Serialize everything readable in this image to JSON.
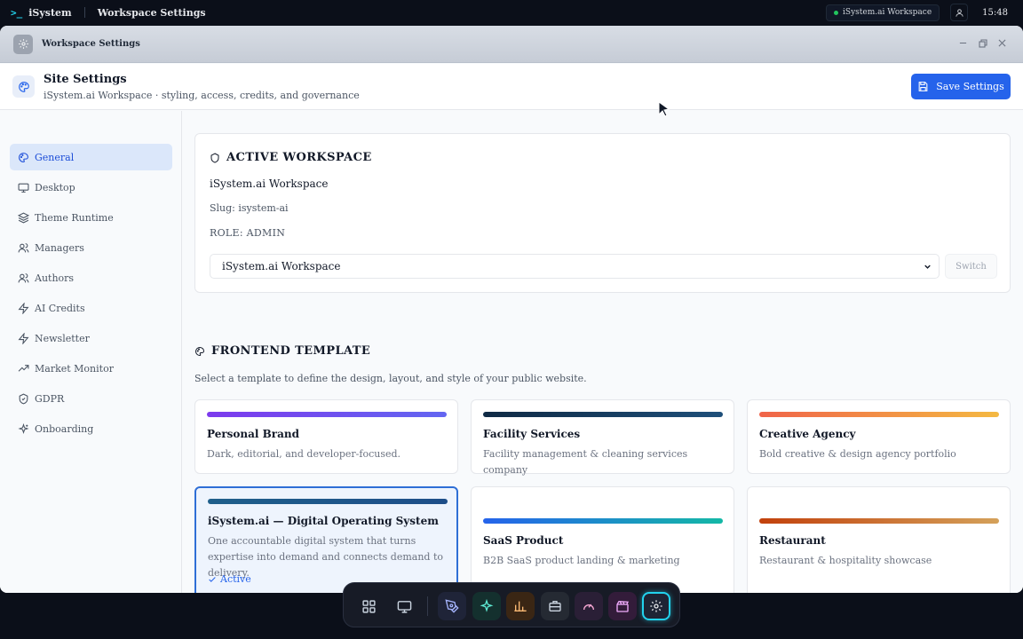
{
  "topbar": {
    "brand": "iSystem",
    "window_title": "Workspace Settings",
    "workspace_pill": "iSystem.ai Workspace",
    "clock": "15:48"
  },
  "window": {
    "title": "Workspace Settings"
  },
  "header": {
    "title": "Site Settings",
    "subtitle": "iSystem.ai Workspace · styling, access, credits, and governance",
    "save_label": "Save Settings"
  },
  "sidebar": {
    "items": [
      {
        "label": "General",
        "icon": "palette-icon",
        "active": true
      },
      {
        "label": "Desktop",
        "icon": "monitor-icon",
        "active": false
      },
      {
        "label": "Theme Runtime",
        "icon": "layers-icon",
        "active": false
      },
      {
        "label": "Managers",
        "icon": "users-icon",
        "active": false
      },
      {
        "label": "Authors",
        "icon": "users-icon",
        "active": false
      },
      {
        "label": "AI Credits",
        "icon": "zap-icon",
        "active": false
      },
      {
        "label": "Newsletter",
        "icon": "zap-icon",
        "active": false
      },
      {
        "label": "Market Monitor",
        "icon": "trending-up-icon",
        "active": false
      },
      {
        "label": "GDPR",
        "icon": "shield-check-icon",
        "active": false
      },
      {
        "label": "Onboarding",
        "icon": "sparkles-icon",
        "active": false
      }
    ]
  },
  "active_workspace": {
    "heading": "ACTIVE WORKSPACE",
    "name": "iSystem.ai Workspace",
    "slug": "Slug: isystem-ai",
    "role": "ROLE: ADMIN",
    "select_value": "iSystem.ai Workspace",
    "switch_label": "Switch"
  },
  "frontend_template": {
    "heading": "FRONTEND TEMPLATE",
    "description": "Select a template to define the design, layout, and style of your public website.",
    "active_label": "Active",
    "templates": [
      {
        "name": "Personal Brand",
        "description": "Dark, editorial, and developer-focused.",
        "gradient": [
          "#7c3aed",
          "#6366f1"
        ],
        "active": false
      },
      {
        "name": "Facility Services",
        "description": "Facility management & cleaning services company",
        "gradient": [
          "#0f2a44",
          "#1e4f7a"
        ],
        "active": false
      },
      {
        "name": "Creative Agency",
        "description": "Bold creative & design agency portfolio",
        "gradient": [
          "#f06449",
          "#f4b942"
        ],
        "active": false
      },
      {
        "name": "iSystem.ai — Digital Operating System",
        "description": "One accountable digital system that turns expertise into demand and connects demand to delivery.",
        "gradient": [
          "#1f5f8b",
          "#1d4e89"
        ],
        "active": true
      },
      {
        "name": "SaaS Product",
        "description": "B2B SaaS product landing & marketing",
        "gradient": [
          "#2563eb",
          "#14b8a6"
        ],
        "active": false
      },
      {
        "name": "Restaurant",
        "description": "Restaurant & hospitality showcase",
        "gradient": [
          "#c2410c",
          "#d4a15a"
        ],
        "active": false
      }
    ]
  },
  "dock": {
    "items": [
      {
        "icon": "apps-grid-icon"
      },
      {
        "icon": "desktop-icon"
      },
      {
        "icon": "pen-tool-icon"
      },
      {
        "icon": "sparkles-icon"
      },
      {
        "icon": "bar-chart-icon"
      },
      {
        "icon": "briefcase-icon"
      },
      {
        "icon": "gauge-icon"
      },
      {
        "icon": "clapperboard-icon"
      },
      {
        "icon": "settings-icon",
        "active": true
      }
    ]
  },
  "colors": {
    "accent": "#2563eb",
    "active_nav_bg": "#dbe7fa",
    "dock_active": "#22d3ee"
  }
}
